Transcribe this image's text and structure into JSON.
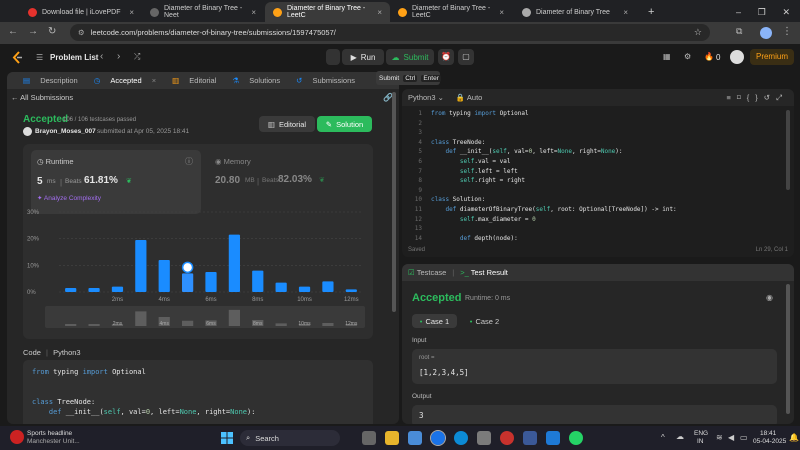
{
  "browser": {
    "tabs": [
      {
        "title": "Download file | iLovePDF",
        "active": false,
        "color": "#e5322d"
      },
      {
        "title": "Diameter of Binary Tree - Neet",
        "active": false,
        "color": "#888888"
      },
      {
        "title": "Diameter of Binary Tree - LeetC",
        "active": true,
        "color": "#ffa116"
      },
      {
        "title": "Diameter of Binary Tree - LeetC",
        "active": false,
        "color": "#ffa116"
      },
      {
        "title": "Diameter of Binary Tree",
        "active": false,
        "color": "#aaaaaa"
      }
    ],
    "url": "leetcode.com/problems/diameter-of-binary-tree/submissions/1597475057/"
  },
  "lcnav": {
    "problem_list": "Problem List",
    "run": "Run",
    "submit": "Submit",
    "coins": "0",
    "premium": "Premium",
    "tooltip": {
      "label": "Submit",
      "k1": "Ctrl",
      "k2": "Enter"
    }
  },
  "left": {
    "tabs": [
      "Description",
      "Accepted",
      "Editorial",
      "Solutions",
      "Submissions"
    ],
    "all_submissions": "All Submissions",
    "status": "Accepted",
    "testcases": "106 / 106 testcases passed",
    "user": "Brayon_Moses_007",
    "submitted": "submitted at Apr 05, 2025 18:41",
    "editorial_btn": "Editorial",
    "solution_btn": "Solution",
    "runtime_label": "Runtime",
    "runtime_value": "5",
    "runtime_unit": "ms",
    "beats_label": "Beats",
    "runtime_beats": "61.81%",
    "analyze": "Analyze Complexity",
    "memory_label": "Memory",
    "memory_value": "20.80",
    "memory_unit": "MB",
    "memory_beats": "82.03%",
    "code_label": "Code",
    "code_lang": "Python3",
    "code_lines": [
      "from typing import Optional",
      "",
      "",
      "class TreeNode:",
      "    def __init__(self, val=0, left=None, right=None):"
    ]
  },
  "chart_data": {
    "type": "bar",
    "y_ticks": [
      "30%",
      "20%",
      "10%",
      "0%"
    ],
    "ylim": [
      0,
      30
    ],
    "x_ticks": [
      "2ms",
      "4ms",
      "6ms",
      "8ms",
      "10ms",
      "12ms"
    ],
    "values": [
      1.5,
      1.5,
      2,
      19.5,
      12,
      7,
      7.5,
      21.5,
      8,
      3.5,
      2,
      4,
      1
    ],
    "highlight_index": 5,
    "grid": true
  },
  "editor": {
    "lang": "Python3",
    "mode": "Auto",
    "saved": "Saved",
    "cursor": "Ln 29, Col 1",
    "lines": [
      "from typing import Optional",
      "",
      "",
      "class TreeNode:",
      "    def __init__(self, val=0, left=None, right=None):",
      "        self.val = val",
      "        self.left = left",
      "        self.right = right",
      "",
      "class Solution:",
      "    def diameterOfBinaryTree(self, root: Optional[TreeNode]) -> int:",
      "        self.max_diameter = 0",
      "",
      "        def depth(node):"
    ]
  },
  "test": {
    "testcase_tab": "Testcase",
    "result_tab": "Test Result",
    "status": "Accepted",
    "runtime": "Runtime: 0 ms",
    "case1": "Case 1",
    "case2": "Case 2",
    "input_label": "Input",
    "input_var": "root =",
    "input_value": "[1,2,3,4,5]",
    "output_label": "Output",
    "output_value": "3"
  },
  "taskbar": {
    "news_title": "Sports headline",
    "news_sub": "Manchester Unit...",
    "search": "Search",
    "lang1": "ENG",
    "lang2": "IN",
    "time": "18:41",
    "date": "05-04-2025"
  },
  "colors": {
    "accepted": "#2cbb5d",
    "bar": "#1a8cff",
    "accent": "#ffa116"
  }
}
